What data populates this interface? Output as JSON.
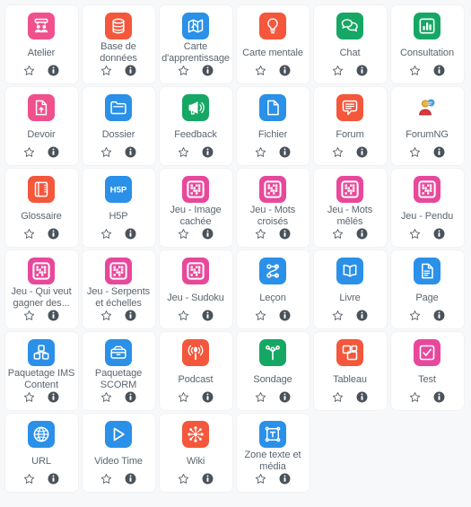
{
  "activities": [
    {
      "label": "Atelier",
      "icon": "workshop-icon",
      "color": "#f0508c"
    },
    {
      "label": "Base de données",
      "icon": "database-icon",
      "color": "#f4573b"
    },
    {
      "label": "Carte d'apprentissage",
      "icon": "learning-map-icon",
      "color": "#2a90e8"
    },
    {
      "label": "Carte mentale",
      "icon": "mindmap-bulb-icon",
      "color": "#f4573b"
    },
    {
      "label": "Chat",
      "icon": "chat-bubbles-icon",
      "color": "#16a765"
    },
    {
      "label": "Consultation",
      "icon": "bar-chart-icon",
      "color": "#16a765"
    },
    {
      "label": "Devoir",
      "icon": "assignment-upload-icon",
      "color": "#f0508c"
    },
    {
      "label": "Dossier",
      "icon": "folder-icon",
      "color": "#2a90e8"
    },
    {
      "label": "Feedback",
      "icon": "megaphone-icon",
      "color": "#16a765"
    },
    {
      "label": "Fichier",
      "icon": "file-icon",
      "color": "#2a90e8"
    },
    {
      "label": "Forum",
      "icon": "forum-bubble-icon",
      "color": "#f4573b"
    },
    {
      "label": "ForumNG",
      "icon": "forumng-person-icon",
      "color": "#ffffff"
    },
    {
      "label": "Glossaire",
      "icon": "glossary-book-icon",
      "color": "#f4573b"
    },
    {
      "label": "H5P",
      "icon": "h5p-icon",
      "color": "#2a90e8"
    },
    {
      "label": "Jeu - Image cachée",
      "icon": "game-grid-icon",
      "color": "#e8489b"
    },
    {
      "label": "Jeu - Mots croisés",
      "icon": "game-grid-icon",
      "color": "#e8489b"
    },
    {
      "label": "Jeu - Mots mêlés",
      "icon": "game-grid-icon",
      "color": "#e8489b"
    },
    {
      "label": "Jeu - Pendu",
      "icon": "game-grid-icon",
      "color": "#e8489b"
    },
    {
      "label": "Jeu - Qui veut gagner des...",
      "icon": "game-grid-icon",
      "color": "#e8489b"
    },
    {
      "label": "Jeu - Serpents et échelles",
      "icon": "game-grid-icon",
      "color": "#e8489b"
    },
    {
      "label": "Jeu - Sudoku",
      "icon": "game-grid-icon",
      "color": "#e8489b"
    },
    {
      "label": "Leçon",
      "icon": "lesson-path-icon",
      "color": "#2a90e8"
    },
    {
      "label": "Livre",
      "icon": "book-icon",
      "color": "#2a90e8"
    },
    {
      "label": "Page",
      "icon": "page-icon",
      "color": "#2a90e8"
    },
    {
      "label": "Paquetage IMS Content",
      "icon": "ims-package-icon",
      "color": "#2a90e8"
    },
    {
      "label": "Paquetage SCORM",
      "icon": "scorm-package-icon",
      "color": "#2a90e8"
    },
    {
      "label": "Podcast",
      "icon": "podcast-icon",
      "color": "#f4573b"
    },
    {
      "label": "Sondage",
      "icon": "survey-icon",
      "color": "#16a765"
    },
    {
      "label": "Tableau",
      "icon": "board-icon",
      "color": "#f4573b"
    },
    {
      "label": "Test",
      "icon": "quiz-check-icon",
      "color": "#e8489b"
    },
    {
      "label": "URL",
      "icon": "globe-icon",
      "color": "#2a90e8"
    },
    {
      "label": "Video Time",
      "icon": "video-play-icon",
      "color": "#2a90e8"
    },
    {
      "label": "Wiki",
      "icon": "wiki-nodes-icon",
      "color": "#f4573b"
    },
    {
      "label": "Zone texte et média",
      "icon": "text-media-icon",
      "color": "#2a90e8"
    }
  ],
  "actions": {
    "favourite_label": "star-outline-icon",
    "info_label": "info-circle-icon"
  },
  "colors": {
    "background": "#f7f8fa",
    "card": "#ffffff",
    "label_text": "#5b6570",
    "info_icon": "#4a525a",
    "star_icon": "#555e66"
  }
}
